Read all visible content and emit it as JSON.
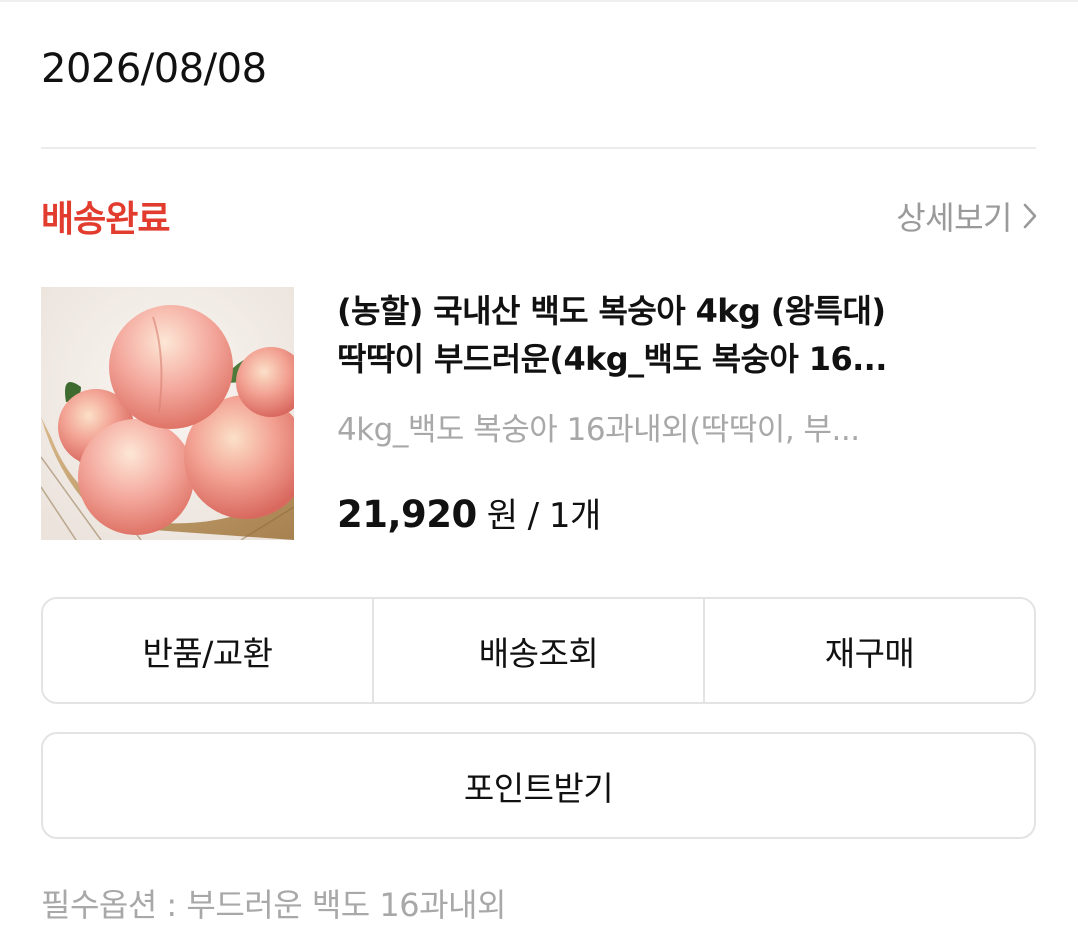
{
  "order": {
    "date": "2026/08/08",
    "status": "배송완료",
    "detail_link": "상세보기"
  },
  "product": {
    "image_alt": "peaches in a basket",
    "name_line1": "(농할) 국내산 백도 복숭아 4kg (왕특대)",
    "name_line2": "딱딱이 부드러운(4kg_백도 복숭아 16...",
    "option": "4kg_백도 복숭아 16과내외(딱딱이, 부...",
    "price": "21,920",
    "currency": "원",
    "quantity": "/ 1개"
  },
  "actions": {
    "return_exchange": "반품/교환",
    "track_delivery": "배송조회",
    "reorder": "재구매",
    "get_points": "포인트받기"
  },
  "required_option": "필수옵션 : 부드러운 백도 16과내외",
  "colors": {
    "status": "#e23c2e",
    "muted": "#a8a8a8",
    "border": "#e3e3e3"
  },
  "icons": {
    "detail_link": "chevron-right-icon"
  }
}
